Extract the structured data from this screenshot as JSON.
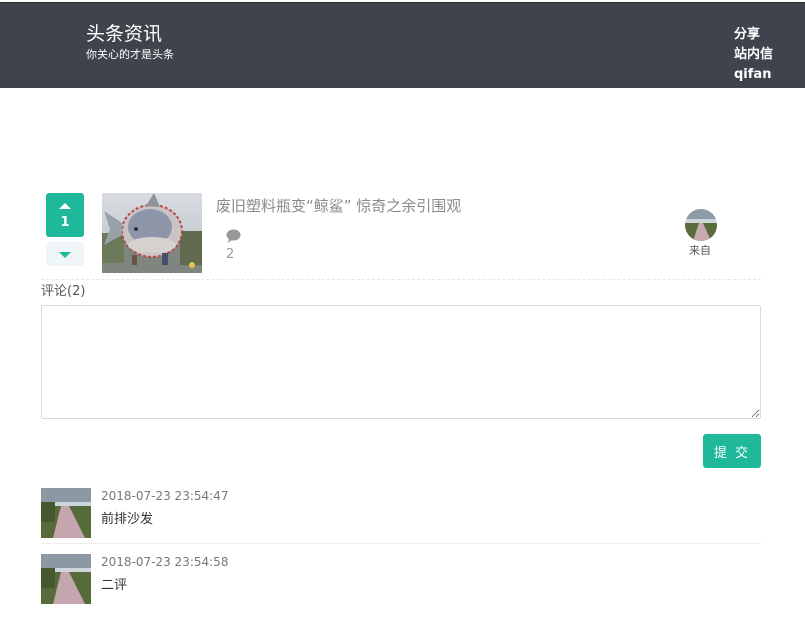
{
  "header": {
    "title": "头条资讯",
    "tagline": "你关心的才是头条",
    "nav": [
      "分享",
      "站内信",
      "qifan"
    ]
  },
  "news": {
    "votes": "1",
    "title": "废旧塑料瓶变“鲸鲨” 惊奇之余引围观",
    "comment_count": "2",
    "author_label": "来自"
  },
  "comment_form": {
    "heading": "评论(2)",
    "textarea_value": "",
    "submit_label": "提 交"
  },
  "comments": [
    {
      "time": "2018-07-23 23:54:47",
      "text": "前排沙发"
    },
    {
      "time": "2018-07-23 23:54:58",
      "text": "二评"
    }
  ],
  "colors": {
    "header_bg": "#3f444c",
    "accent": "#1fb89a"
  },
  "icons": [
    "vote-up-icon",
    "vote-down-icon",
    "comment-bubble-icon"
  ]
}
